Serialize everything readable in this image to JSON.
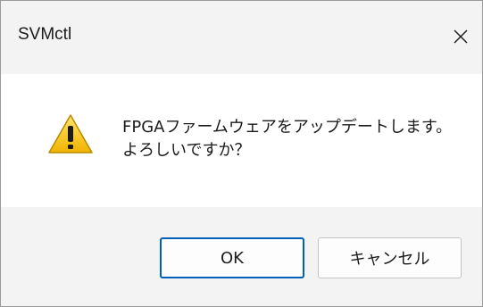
{
  "window": {
    "title": "SVMctl"
  },
  "controls": {
    "close_glyph": "✕"
  },
  "message": {
    "line1": "FPGAファームウェアをアップデートします。",
    "line2": "よろしいですか？",
    "icon": "warning-icon"
  },
  "buttons": {
    "ok_label": "OK",
    "cancel_label": "キャンセル"
  },
  "colors": {
    "accent": "#005fb8",
    "warning": "#f4c20d"
  }
}
